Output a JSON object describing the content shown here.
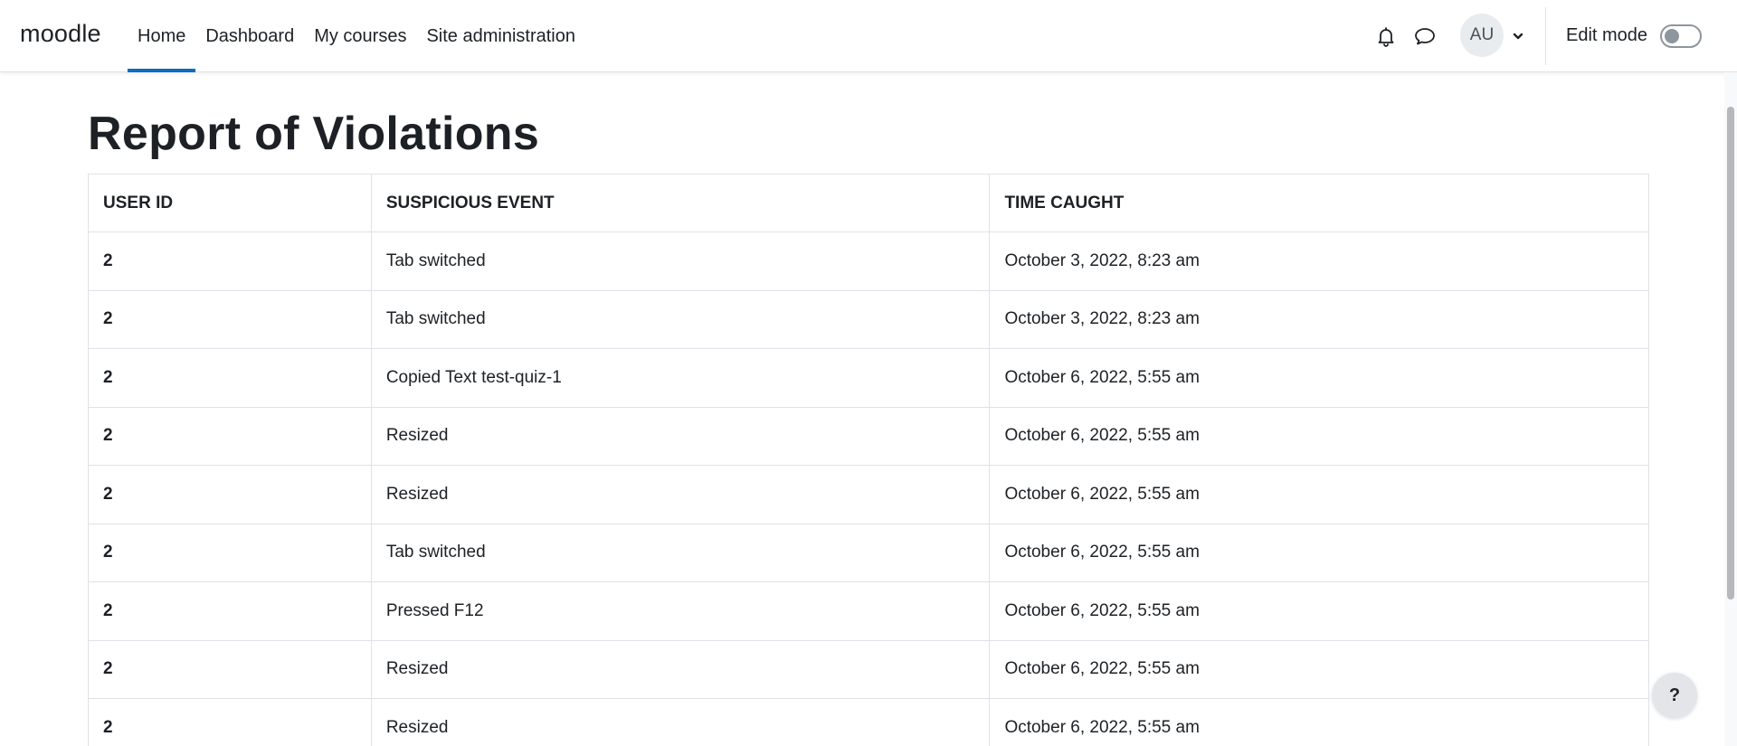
{
  "header": {
    "brand": "moodle",
    "nav": [
      {
        "label": "Home",
        "active": true
      },
      {
        "label": "Dashboard",
        "active": false
      },
      {
        "label": "My courses",
        "active": false
      },
      {
        "label": "Site administration",
        "active": false
      }
    ],
    "icons": {
      "notifications": "bell-icon",
      "messages": "chat-bubble-icon",
      "user_menu": "chevron-down-icon"
    },
    "avatar_initials": "AU",
    "edit_mode_label": "Edit mode",
    "edit_mode_on": false,
    "accent_color": "#0f6cbf"
  },
  "page": {
    "title": "Report of Violations"
  },
  "table": {
    "columns": [
      "USER ID",
      "SUSPICIOUS EVENT",
      "TIME CAUGHT"
    ],
    "rows": [
      {
        "user_id": "2",
        "event": "Tab switched",
        "time": "October 3, 2022, 8:23 am"
      },
      {
        "user_id": "2",
        "event": "Tab switched",
        "time": "October 3, 2022, 8:23 am"
      },
      {
        "user_id": "2",
        "event": "Copied Text test-quiz-1",
        "time": "October 6, 2022, 5:55 am"
      },
      {
        "user_id": "2",
        "event": "Resized",
        "time": "October 6, 2022, 5:55 am"
      },
      {
        "user_id": "2",
        "event": "Resized",
        "time": "October 6, 2022, 5:55 am"
      },
      {
        "user_id": "2",
        "event": "Tab switched",
        "time": "October 6, 2022, 5:55 am"
      },
      {
        "user_id": "2",
        "event": "Pressed F12",
        "time": "October 6, 2022, 5:55 am"
      },
      {
        "user_id": "2",
        "event": "Resized",
        "time": "October 6, 2022, 5:55 am"
      },
      {
        "user_id": "2",
        "event": "Resized",
        "time": "October 6, 2022, 5:55 am"
      }
    ]
  },
  "help_button": {
    "label": "?"
  }
}
